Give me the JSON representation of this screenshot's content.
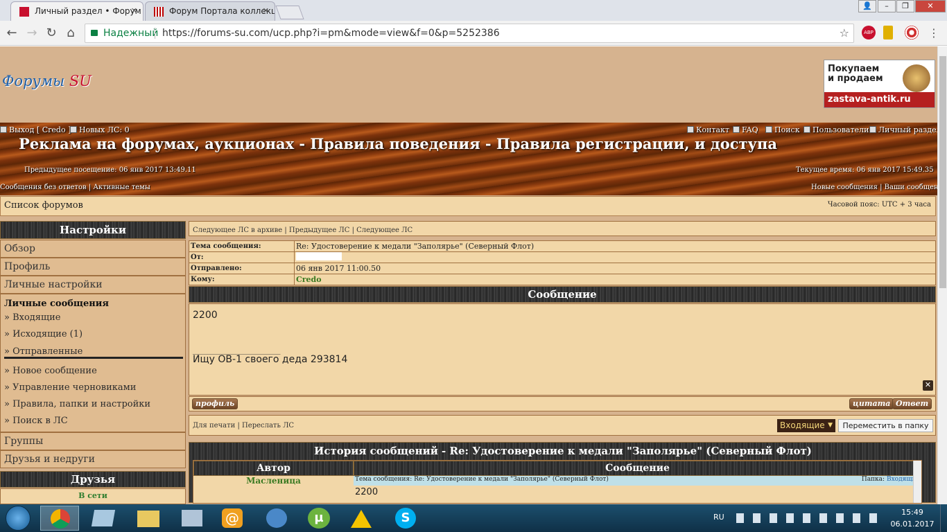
{
  "browser": {
    "tabs": [
      {
        "label": "Личный раздел • Форум"
      },
      {
        "label": "Форум Портала коллекц"
      }
    ],
    "secure_label": "Надежный",
    "url": "https://forums-su.com/ucp.php?i=pm&mode=view&f=0&p=5252386",
    "extensions": [
      {
        "name": "abp-icon",
        "badge": "4",
        "color": "#c8102e"
      },
      {
        "name": "flag-icon",
        "color": "#e0b000"
      },
      {
        "name": "target-icon",
        "color": "#d03030"
      }
    ]
  },
  "site": {
    "logo_a": "Форумы ",
    "logo_b": "SU",
    "banner": {
      "text": "Покупаем\nи продаем",
      "url": "zastava-antik.ru"
    }
  },
  "topnav": {
    "logout": "Выход [ Credo ]",
    "new_pm": "Новых ЛС: 0",
    "right": [
      {
        "label": "Контакт"
      },
      {
        "label": "FAQ"
      },
      {
        "label": "Поиск"
      },
      {
        "label": "Пользователи"
      },
      {
        "label": "Личный раздел"
      }
    ],
    "title": "Реклама на форумах, аукционах - Правила поведения - Правила регистрации, и доступа",
    "prev_visit": "Предыдущее посещение: 06 янв 2017 13:49.11",
    "cur_time": "Текущее время: 06 янв 2017 15:49.35",
    "left_links": "Сообщения без ответов | Активные темы",
    "right_links": "Новые сообщения | Ваши сообщения"
  },
  "breadcrumb": {
    "label": "Список форумов",
    "tz": "Часовой пояс: UTC + 3 часа"
  },
  "sidebar": {
    "title": "Настройки",
    "items": [
      {
        "label": "Обзор"
      },
      {
        "label": "Профиль"
      },
      {
        "label": "Личные настройки"
      }
    ],
    "pm_title": "Личные сообщения",
    "pm_items": [
      {
        "label": "» Входящие"
      },
      {
        "label": "» Исходящие (1)"
      },
      {
        "label": "» Отправленные"
      }
    ],
    "pm_more": [
      {
        "label": "» Новое сообщение"
      },
      {
        "label": "» Управление черновиками"
      },
      {
        "label": "» Правила, папки и настройки"
      },
      {
        "label": "» Поиск в ЛС"
      }
    ],
    "groups": "Группы",
    "friends_foes": "Друзья и недруги",
    "friends_title": "Друзья",
    "online": "В сети"
  },
  "pm": {
    "nav": "Следующее ЛС в архиве | Предыдущее ЛС | Следующее ЛС",
    "fields": [
      {
        "key": "Тема сообщения:",
        "value": "Re: Удостоверение к медали \"Заполярье\" (Северный Флот)"
      },
      {
        "key": "От:",
        "value": ""
      },
      {
        "key": "Отправлено:",
        "value": "06 янв 2017 11:00.50"
      },
      {
        "key": "Кому:",
        "value": "Credo"
      }
    ],
    "section_title": "Сообщение",
    "body_line1": "2200",
    "signature_rule": "_______________________",
    "signature": "Ищу ОВ-1 своего деда 293814",
    "btn_profile": "профиль",
    "btn_quote": "цитата",
    "btn_reply": "Ответ",
    "print_links": "Для печати | Переслать ЛС",
    "folder_selected": "Входящие",
    "move_button": "Переместить в папку"
  },
  "history": {
    "title": "История сообщений - Re: Удостоверение к медали \"Заполярье\" (Северный Флот)",
    "col_author": "Автор",
    "col_message": "Сообщение",
    "author": "Масленица",
    "subject": "Тема сообщения: Re: Удостоверение к медали \"Заполярье\" (Северный Флот)",
    "folder_label": "Папка:",
    "folder_value": "Входящие",
    "preview": "2200"
  },
  "taskbar": {
    "lang": "RU",
    "time": "15:49",
    "date": "06.01.2017"
  }
}
